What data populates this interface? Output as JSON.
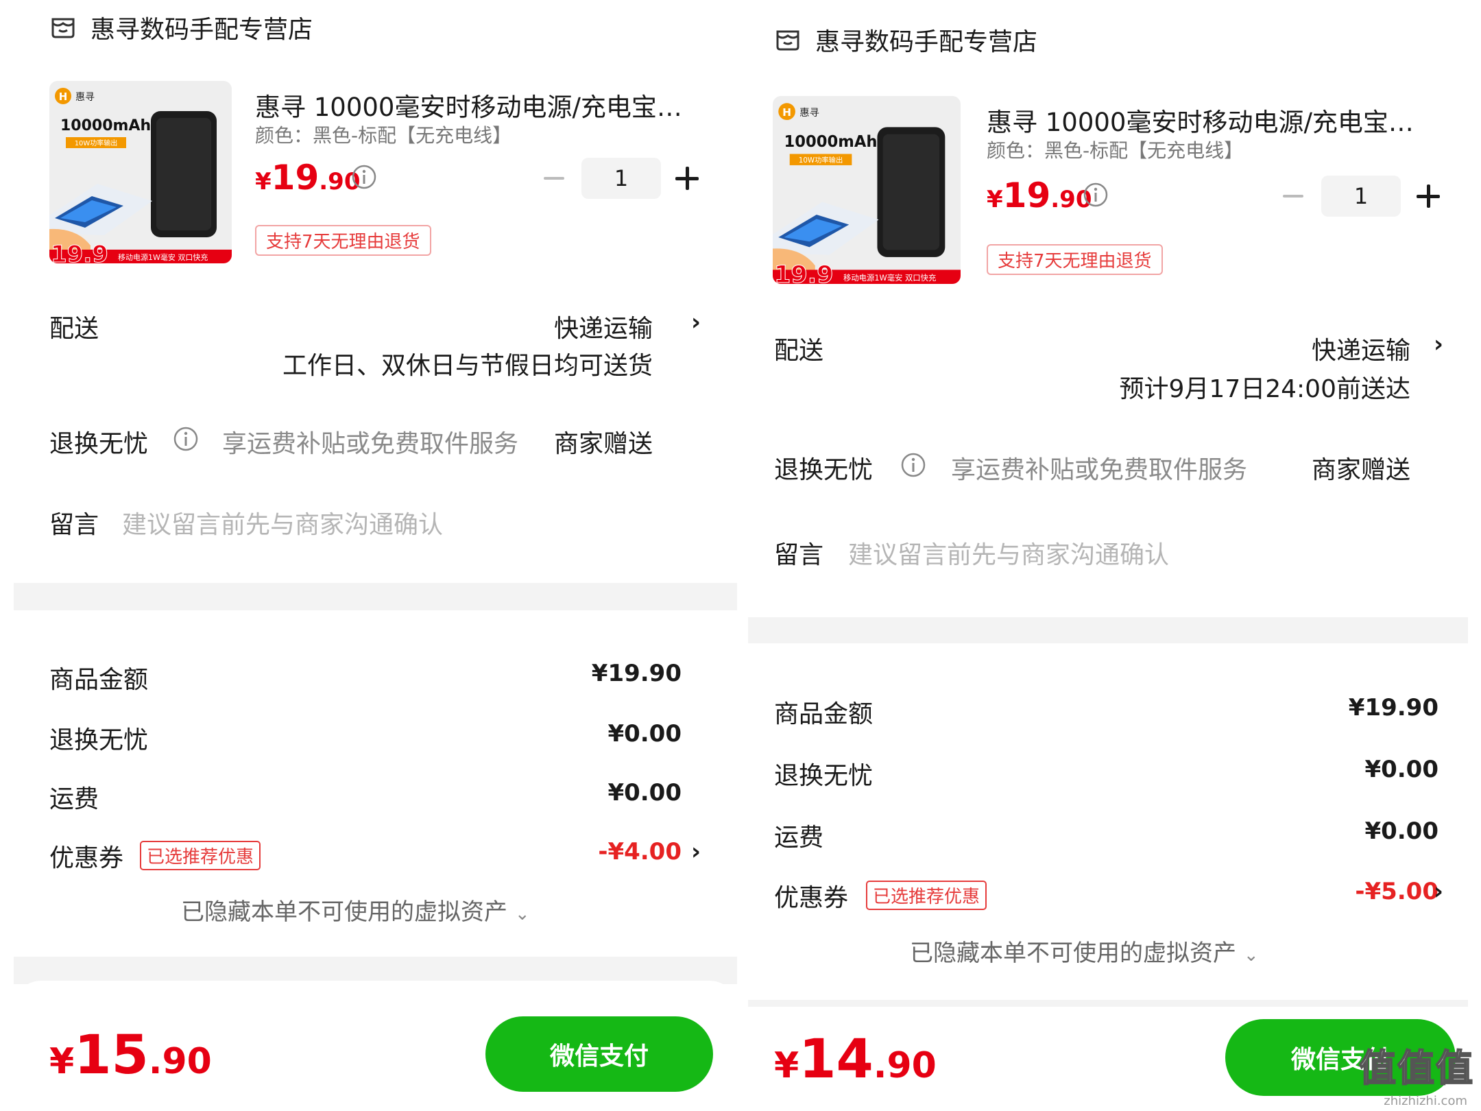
{
  "colors": {
    "accent_red": "#e60012",
    "pay_green": "#15b815",
    "badge_red": "#e63b3b"
  },
  "panels": [
    {
      "store_name": "惠寻数码手配专营店",
      "product": {
        "title": "惠寻  10000毫安时移动电源/充电宝…",
        "spec": "颜色：黑色-标配【无充电线】",
        "price_yen": "¥",
        "price_int": "19",
        "price_dec": ".90",
        "quantity": "1",
        "return_badge": "支持7天无理由退货",
        "thumb": {
          "brand": "惠寻",
          "capacity": "10000mAh",
          "tag": "10W功率输出",
          "promo_price": "19.9",
          "promo_text": "移动电源1W毫安 双口快充"
        }
      },
      "delivery": {
        "label": "配送",
        "method": "快递运输",
        "note": "工作日、双休日与节假日均可送货"
      },
      "worry_free": {
        "label": "退换无忧",
        "desc": "享运费补贴或免费取件服务",
        "value": "商家赠送"
      },
      "message": {
        "label": "留言",
        "placeholder": "建议留言前先与商家沟通确认"
      },
      "summary": {
        "goods_label": "商品金额",
        "goods_value": "¥19.90",
        "worry_label": "退换无忧",
        "worry_value": "¥0.00",
        "shipping_label": "运费",
        "shipping_value": "¥0.00",
        "coupon_label": "优惠券",
        "coupon_tag": "已选推荐优惠",
        "coupon_value": "-¥4.00",
        "hidden_assets": "已隐藏本单不可使用的虚拟资产"
      },
      "footer": {
        "total_yen": "¥",
        "total_int": "15",
        "total_dec": ".90",
        "pay_label": "微信支付"
      }
    },
    {
      "store_name": "惠寻数码手配专营店",
      "product": {
        "title": "惠寻  10000毫安时移动电源/充电宝…",
        "spec": "颜色：黑色-标配【无充电线】",
        "price_yen": "¥",
        "price_int": "19",
        "price_dec": ".90",
        "quantity": "1",
        "return_badge": "支持7天无理由退货",
        "thumb": {
          "brand": "惠寻",
          "capacity": "10000mAh",
          "tag": "10W功率输出",
          "promo_price": "19.9",
          "promo_text": "移动电源1W毫安 双口快充"
        }
      },
      "delivery": {
        "label": "配送",
        "method": "快递运输",
        "note": "预计9月17日24:00前送达"
      },
      "worry_free": {
        "label": "退换无忧",
        "desc": "享运费补贴或免费取件服务",
        "value": "商家赠送"
      },
      "message": {
        "label": "留言",
        "placeholder": "建议留言前先与商家沟通确认"
      },
      "summary": {
        "goods_label": "商品金额",
        "goods_value": "¥19.90",
        "worry_label": "退换无忧",
        "worry_value": "¥0.00",
        "shipping_label": "运费",
        "shipping_value": "¥0.00",
        "coupon_label": "优惠券",
        "coupon_tag": "已选推荐优惠",
        "coupon_value": "-¥5.00",
        "hidden_assets": "已隐藏本单不可使用的虚拟资产"
      },
      "footer": {
        "total_yen": "¥",
        "total_int": "14",
        "total_dec": ".90",
        "pay_label": "微信支付"
      }
    }
  ],
  "watermark": {
    "text": "值值值",
    "url": "zhizhizhi.com"
  }
}
